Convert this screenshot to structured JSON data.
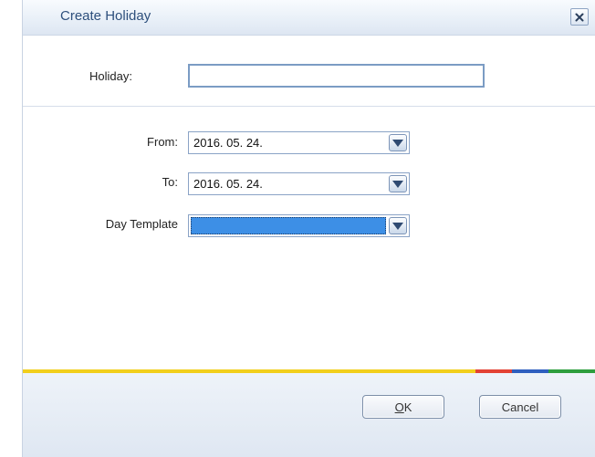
{
  "dialog": {
    "title": "Create Holiday",
    "close_icon": "close-icon"
  },
  "form": {
    "holiday_label": "Holiday:",
    "holiday_value": "",
    "from_label": "From:",
    "from_value": "2016. 05. 24.",
    "to_label": "To:",
    "to_value": "2016. 05. 24.",
    "day_template_label": "Day Template",
    "day_template_value": ""
  },
  "buttons": {
    "ok_first": "O",
    "ok_rest": "K",
    "cancel": "Cancel"
  },
  "colors": {
    "accent_stripe": [
      "#f2cf1c",
      "#e34234",
      "#2f5fbf",
      "#2e9e3e"
    ],
    "selection": "#3d8fe6",
    "title_text": "#2d4f7c"
  }
}
